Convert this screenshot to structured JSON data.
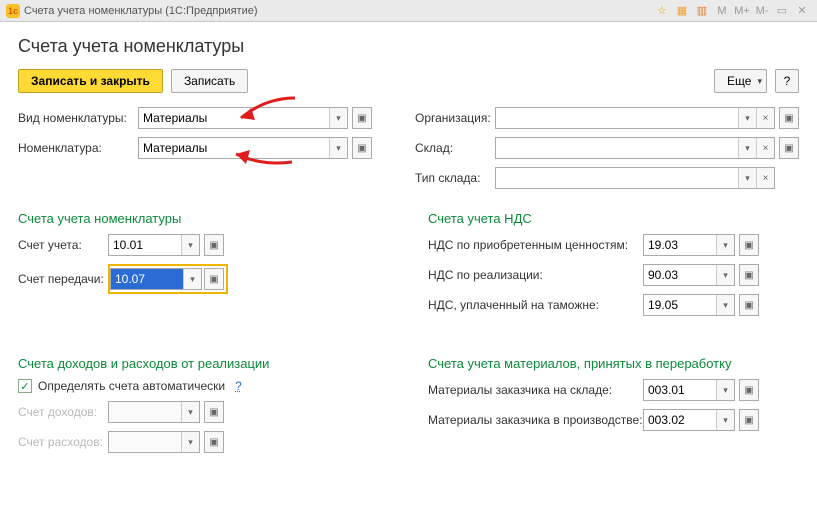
{
  "window": {
    "title": "Счета учета номенклатуры  (1С:Предприятие)"
  },
  "header": {
    "title": "Счета учета номенклатуры"
  },
  "toolbar": {
    "save_close": "Записать и закрыть",
    "save": "Записать",
    "more": "Еще",
    "help": "?"
  },
  "fields": {
    "vid_nom_label": "Вид номенклатуры:",
    "vid_nom_value": "Материалы",
    "nom_label": "Номенклатура:",
    "nom_value": "Материалы",
    "org_label": "Организация:",
    "org_value": "",
    "sklad_label": "Склад:",
    "sklad_value": "",
    "tip_sklada_label": "Тип склада:",
    "tip_sklada_value": ""
  },
  "section_accounts": {
    "title": "Счета учета номенклатуры",
    "schet_ucheta_label": "Счет учета:",
    "schet_ucheta_value": "10.01",
    "schet_peredachi_label": "Счет передачи:",
    "schet_peredachi_value": "10.07"
  },
  "section_nds": {
    "title": "Счета учета НДС",
    "nds_prio_label": "НДС по приобретенным ценностям:",
    "nds_prio_value": "19.03",
    "nds_real_label": "НДС по реализации:",
    "nds_real_value": "90.03",
    "nds_tam_label": "НДС, уплаченный на таможне:",
    "nds_tam_value": "19.05"
  },
  "section_income": {
    "title": "Счета доходов и расходов от реализации",
    "auto_label": "Определять счета автоматически",
    "auto_checked": true,
    "dohod_label": "Счет доходов:",
    "dohod_value": "",
    "rashod_label": "Счет расходов:",
    "rashod_value": ""
  },
  "section_mat": {
    "title": "Счета учета материалов, принятых в переработку",
    "mat_sklad_label": "Материалы заказчика на складе:",
    "mat_sklad_value": "003.01",
    "mat_proizv_label": "Материалы заказчика в производстве:",
    "mat_proizv_value": "003.02"
  },
  "icons": {
    "chevron": "▾",
    "expand": "▣",
    "close": "×",
    "check": "✓",
    "help": "?"
  }
}
